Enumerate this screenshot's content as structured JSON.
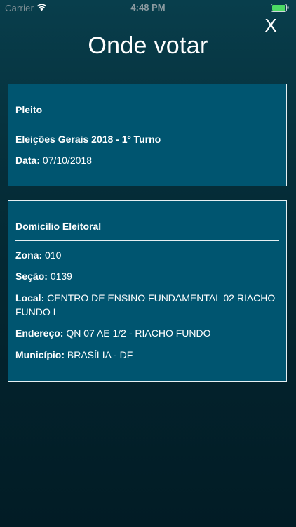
{
  "status_bar": {
    "carrier": "Carrier",
    "time": "4:48 PM",
    "wifi_icon": "wifi-icon",
    "battery_icon": "battery-icon",
    "battery_color": "#4cd964"
  },
  "header": {
    "title": "Onde votar",
    "close_label": "X"
  },
  "pleito": {
    "title": "Pleito",
    "election": "Eleições Gerais 2018 - 1º Turno",
    "date_label": "Data:",
    "date_value": "07/10/2018"
  },
  "domicilio": {
    "title": "Domicílio Eleitoral",
    "zona_label": "Zona:",
    "zona_value": "010",
    "secao_label": "Seção:",
    "secao_value": "0139",
    "local_label": "Local:",
    "local_value": "CENTRO DE ENSINO FUNDAMENTAL 02 RIACHO FUNDO I",
    "endereco_label": "Endereço:",
    "endereco_value": "QN 07 AE 1/2 - RIACHO FUNDO",
    "municipio_label": "Município:",
    "municipio_value": "BRASÍLIA - DF"
  },
  "colors": {
    "card_background": "#005570",
    "card_border": "#e6f0f3",
    "page_background": "#032a35"
  }
}
